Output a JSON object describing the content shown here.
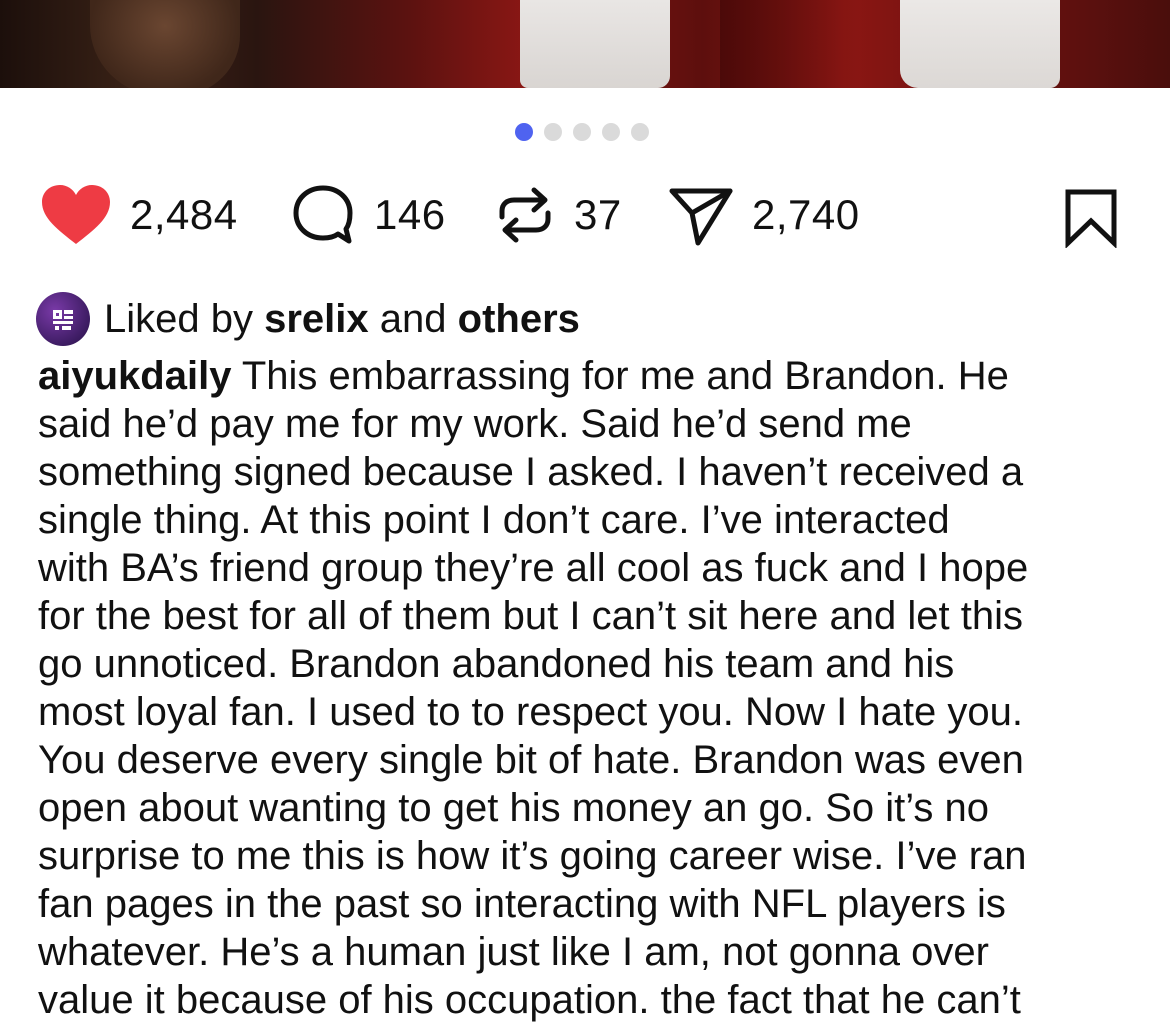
{
  "post": {
    "dots": {
      "total": 5,
      "active_index": 0,
      "active_color": "#4f63f0",
      "inactive_color": "#dadada"
    }
  },
  "actions": {
    "like": {
      "icon": "heart-icon",
      "count": "2,484",
      "color": "#ee3b44"
    },
    "comment": {
      "icon": "comment-bubble-icon",
      "count": "146"
    },
    "repost": {
      "icon": "repost-icon",
      "count": "37"
    },
    "share": {
      "icon": "send-icon",
      "count": "2,740"
    },
    "bookmark": {
      "icon": "bookmark-icon"
    }
  },
  "liked_by": {
    "avatar_icon": "user-avatar-icon",
    "prefix": "Liked by",
    "user": "srelix",
    "joiner": "and",
    "others": "others"
  },
  "caption": {
    "username": "aiyukdaily",
    "first_line_rest": "This embarrassing for me and Brandon. He",
    "lines": [
      "said he’d pay me for my work. Said he’d send me",
      "something signed because I asked. I haven’t received a",
      "single thing. At this point I don’t care. I’ve interacted",
      "with BA’s friend group they’re all cool as fuck and I hope",
      "for the best for all of them but I can’t sit here and let this",
      "go unnoticed. Brandon abandoned his team and his",
      "most loyal fan. I used to to respect you. Now I hate you.",
      "You deserve every single bit of hate. Brandon was even",
      "open about wanting to get his money an go. So it’s no",
      "surprise to me this is how it’s going career wise. I’ve ran",
      "fan pages in the past so interacting with NFL players is",
      "whatever. He’s a human just like I am, not gonna over",
      "value it because of his occupation. the fact that he can’t"
    ]
  }
}
